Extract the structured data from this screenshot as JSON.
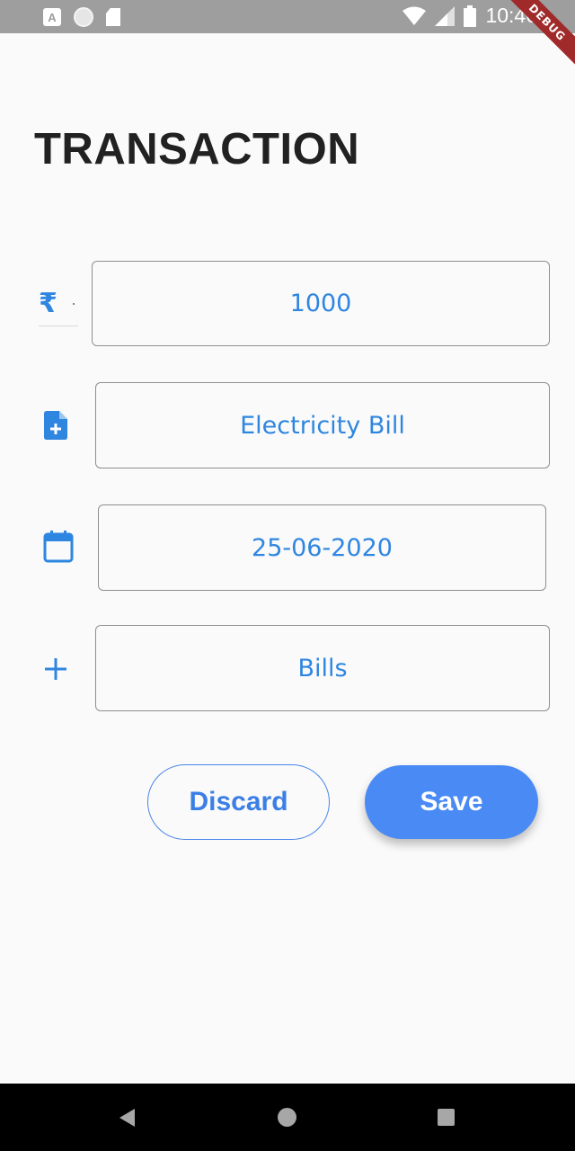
{
  "status_bar": {
    "time": "10:46",
    "left_icons": [
      "a-notification-icon",
      "circle-notification-icon",
      "sd-card-icon"
    ],
    "right_icons": [
      "wifi-icon",
      "signal-icon",
      "battery-icon"
    ],
    "debug_banner": "DEBUG"
  },
  "page": {
    "title": "TRANSACTION"
  },
  "form": {
    "amount": {
      "icon": "rupee-icon",
      "value": "1000"
    },
    "description": {
      "icon": "note-add-icon",
      "value": "Electricity Bill"
    },
    "date": {
      "icon": "calendar-icon",
      "value": "25-06-2020"
    },
    "category": {
      "icon": "plus-icon",
      "value": "Bills"
    }
  },
  "actions": {
    "discard_label": "Discard",
    "save_label": "Save"
  },
  "colors": {
    "accent": "#2f86e0",
    "primary_button": "#4a8af4",
    "title": "#212121"
  }
}
